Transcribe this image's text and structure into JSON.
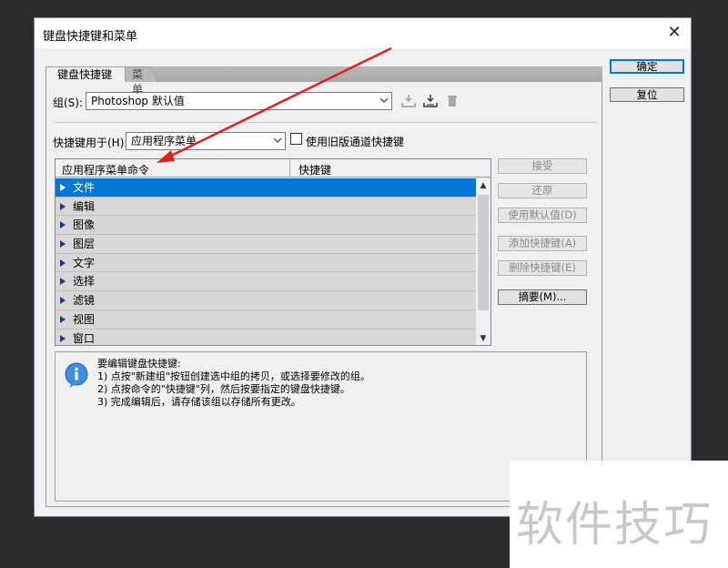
{
  "dialog": {
    "title": "键盘快捷键和菜单",
    "close_glyph": "✕",
    "ok_label": "确定",
    "reset_label": "复位"
  },
  "tabs": [
    {
      "label": "键盘快捷键"
    },
    {
      "label": "菜单"
    }
  ],
  "group": {
    "label": "组(S):",
    "value": "Photoshop 默认值"
  },
  "shortcuts_for": {
    "label": "快捷键用于(H):",
    "value": "应用程序菜单",
    "legacy_checkbox_label": "使用旧版通道快捷键",
    "legacy_checked": false
  },
  "table": {
    "columns": [
      "应用程序菜单命令",
      "快捷键"
    ],
    "rows": [
      {
        "label": "文件",
        "selected": true
      },
      {
        "label": "编辑",
        "selected": false
      },
      {
        "label": "图像",
        "selected": false
      },
      {
        "label": "图层",
        "selected": false
      },
      {
        "label": "文字",
        "selected": false
      },
      {
        "label": "选择",
        "selected": false
      },
      {
        "label": "滤镜",
        "selected": false
      },
      {
        "label": "视图",
        "selected": false
      },
      {
        "label": "窗口",
        "selected": false
      }
    ]
  },
  "side_buttons": {
    "accept": "接受",
    "undo": "还原",
    "use_default": "使用默认值(D)",
    "add_shortcut": "添加快捷键(A)",
    "delete_shortcut": "删除快捷键(E)",
    "summary": "摘要(M)..."
  },
  "info": {
    "lines": [
      "要编辑键盘快捷键:",
      "1) 点按\"新建组\"按钮创建选中组的拷贝，或选择要修改的组。",
      "2) 点按命令的\"快捷键\"列，然后按要指定的键盘快捷键。",
      "3) 完成编辑后，请存储该组以存储所有更改。"
    ]
  },
  "watermark": {
    "text": "软件技巧"
  },
  "colors": {
    "selection": "#0078d7",
    "annotation_arrow": "#e02020"
  }
}
